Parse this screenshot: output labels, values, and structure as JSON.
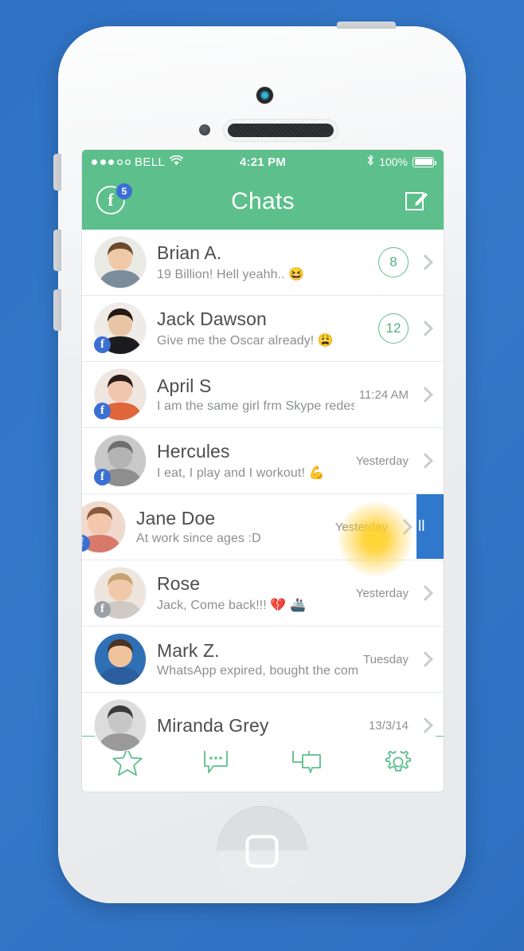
{
  "device": {
    "name": "white-smartphone-mockup",
    "home_button": "home-button",
    "camera": "front-camera",
    "speaker": "earpiece-speaker",
    "buttons": [
      "silent-switch",
      "volume-up",
      "volume-down",
      "power-button"
    ]
  },
  "colors": {
    "background_blue": "#2f72c4",
    "header_green": "#5cbf8c",
    "badge_blue": "#3b6fd4",
    "swipe_blue": "#2f78cc",
    "glow_yellow": "#ffd629",
    "name_text": "#4d4d4d",
    "message_text": "#8c8f92"
  },
  "status_bar": {
    "signal_dots_filled": 3,
    "signal_dots_total": 5,
    "carrier": "BELL",
    "wifi": "wifi-icon",
    "time": "4:21 PM",
    "bluetooth": "bluetooth-icon",
    "battery_percent": "100%",
    "battery_level": 100
  },
  "nav_bar": {
    "facebook_letter": "f",
    "facebook_badge": "5",
    "title": "Chats",
    "compose": "compose-icon"
  },
  "chats": [
    {
      "name": "Brian A.",
      "message": "19 Billion! Hell yeahh.. 😆",
      "unread": "8",
      "time": "",
      "fb_badge": false,
      "avatar": "man-short-brown-hair"
    },
    {
      "name": "Jack Dawson",
      "message": "Give me the Oscar already! 😩",
      "unread": "12",
      "time": "",
      "fb_badge": true,
      "avatar": "man-suit-dark-hair"
    },
    {
      "name": "April S",
      "message": "I am the same girl frm Skype redesign!",
      "unread": "",
      "time": "11:24 AM",
      "fb_badge": true,
      "avatar": "woman-curly-dark-hair"
    },
    {
      "name": "Hercules",
      "message": "I eat, I play and I workout! 💪",
      "unread": "",
      "time": "Yesterday",
      "fb_badge": true,
      "avatar": "muscular-man-bw"
    },
    {
      "name": "Jane Doe",
      "message": "At work since ages :D",
      "unread": "",
      "time": "Yesterday",
      "fb_badge": true,
      "avatar": "woman-long-brown-hair",
      "swiped": true,
      "swipe_action_label": "ll"
    },
    {
      "name": "Rose",
      "message": "Jack, Come back!!! 💔 🚢",
      "unread": "",
      "time": "Yesterday",
      "fb_badge": true,
      "fb_badge_gray": true,
      "avatar": "woman-blonde-bob"
    },
    {
      "name": "Mark Z.",
      "message": "WhatsApp expired, bought the company",
      "unread": "",
      "time": "Tuesday",
      "fb_badge": false,
      "avatar": "man-curly-hair-blue-bg"
    },
    {
      "name": "Miranda Grey",
      "message": "",
      "unread": "",
      "time": "13/3/14",
      "fb_badge": false,
      "avatar": "woman-dark-hair-bw"
    }
  ],
  "tab_bar": {
    "tabs": [
      {
        "icon": "star-icon",
        "label": "Favorites"
      },
      {
        "icon": "speech-bubble-icon",
        "label": "Chats"
      },
      {
        "icon": "double-chat-bubble-icon",
        "label": "Groups"
      },
      {
        "icon": "gear-icon",
        "label": "Settings"
      }
    ]
  }
}
